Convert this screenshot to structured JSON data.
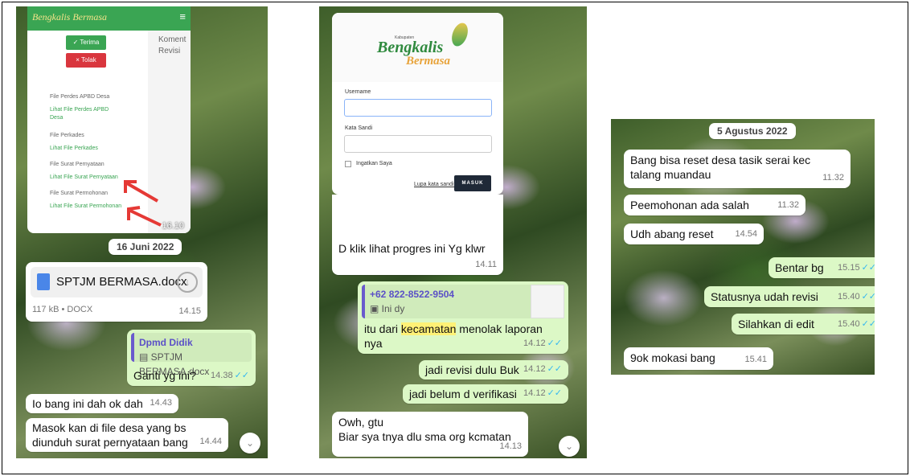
{
  "left_phone": {
    "shot": {
      "logo": "Bengkalis Bermasa",
      "right_text_1": "Koment",
      "right_text_2": "Revisi",
      "terima": "✓ Terima",
      "tolak": "× Tolak",
      "items": [
        {
          "label": "File Perdes APBD Desa",
          "link": "Lihat File Perdes APBD Desa"
        },
        {
          "label": "File Perkades",
          "link": "Lihat File Perkades"
        },
        {
          "label": "File Surat Pernyataan",
          "link": "Lihat File Surat Pernyataan"
        },
        {
          "label": "File Surat Permohonan",
          "link": "Lihat File Surat Permohonan"
        }
      ],
      "time": "16.10"
    },
    "date_chip": "16 Juni 2022",
    "file_msg": {
      "name": "SPTJM BERMASA.docx",
      "meta": "117 kB • DOCX",
      "time": "14.15"
    },
    "reply_msg": {
      "quote_name": "Dpmd Didik",
      "quote_text": "SPTJM BERMASA.docx",
      "text": "Ganti yg ini?",
      "time": "14.38"
    },
    "msg1": {
      "text": "Io bang ini dah ok dah",
      "time": "14.43"
    },
    "msg2": {
      "text": "Masok kan di file desa yang bs diunduh surat pernyataan bang",
      "time": "14.44"
    }
  },
  "middle_phone": {
    "login": {
      "logo_small": "Kabupaten",
      "logo_main": "Bengkalis",
      "logo_sub": "Bermasa",
      "username_label": "Username",
      "password_label": "Kata Sandi",
      "remember": "Ingatkan Saya",
      "forgot": "Lupa kata sandi?",
      "submit": "MASUK"
    },
    "msg1": {
      "text": "D klik lihat progres ini Yg klwr",
      "time": "14.11"
    },
    "reply_msg": {
      "quote_name": "+62 822-8522-9504",
      "quote_text": "Ini dy",
      "text_pre": "itu dari ",
      "text_hl": "kecamatan",
      "text_post": " menolak laporan nya",
      "time": "14.12"
    },
    "msg2": {
      "text": "jadi revisi dulu Buk",
      "time": "14.12"
    },
    "msg3": {
      "text": "jadi belum d verifikasi",
      "time": "14.12"
    },
    "msg4": {
      "text": "Owh, gtu\nBiar sya tnya dlu sma org kcmatan",
      "time": "14.13"
    }
  },
  "right_phone": {
    "date_chip": "5 Agustus 2022",
    "messages": [
      {
        "text": "Bang bisa reset desa tasik serai  kec talang muandau",
        "time": "11.32"
      },
      {
        "text": "Peemohonan ada salah",
        "time": "11.32"
      },
      {
        "text": "Udh abang reset",
        "time": "14.54"
      },
      {
        "text": "Bentar bg",
        "time": "15.15"
      },
      {
        "text": "Statusnya udah revisi",
        "time": "15.40"
      },
      {
        "text": "Silahkan di edit",
        "time": "15.40"
      },
      {
        "text": "9ok mokasi bang",
        "time": "15.41"
      }
    ]
  },
  "icons": {
    "ticks": "✓✓",
    "scroll": "⌄",
    "download": "↓"
  }
}
